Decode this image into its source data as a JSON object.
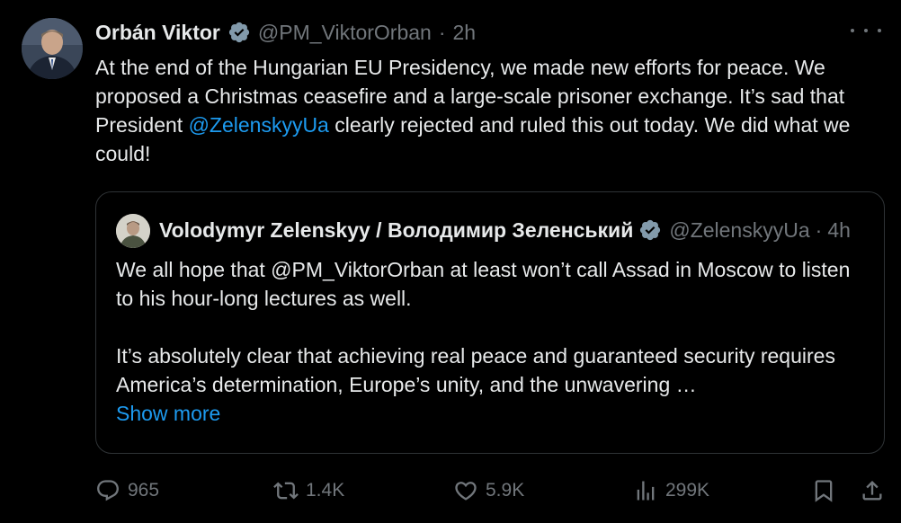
{
  "tweet": {
    "author_name": "Orbán Viktor",
    "handle": "@PM_ViktorOrban",
    "separator": "·",
    "time": "2h",
    "text_before_mention": "At the end of the Hungarian EU Presidency, we made new efforts for peace. We proposed a Christmas ceasefire and a large-scale prisoner exchange. It’s sad that President ",
    "mention": "@ZelenskyyUa",
    "text_after_mention": " clearly rejected and ruled this out today. We did what we could!"
  },
  "quote": {
    "author_name": "Volodymyr Zelenskyy / Володимир Зеленський",
    "handle": "@ZelenskyyUa",
    "separator": "·",
    "time": "4h",
    "paragraph1": "We all hope that @PM_ViktorOrban at least won’t call Assad in Moscow to listen to his hour-long lectures as well.",
    "paragraph2": "It’s absolutely clear that achieving real peace and guaranteed security requires America’s determination, Europe’s unity, and the unwavering …",
    "show_more": "Show more"
  },
  "actions": {
    "replies": "965",
    "reposts": "1.4K",
    "likes": "5.9K",
    "views": "299K"
  },
  "colors": {
    "background": "#000000",
    "text": "#e7e9ea",
    "muted": "#71767b",
    "accent": "#1d9bf0",
    "border": "#2f3336"
  },
  "icons": {
    "verified": "verified-badge-icon",
    "more": "more-options-icon",
    "reply": "reply-icon",
    "repost": "repost-icon",
    "like": "like-icon",
    "views": "views-icon",
    "bookmark": "bookmark-icon",
    "share": "share-icon"
  }
}
